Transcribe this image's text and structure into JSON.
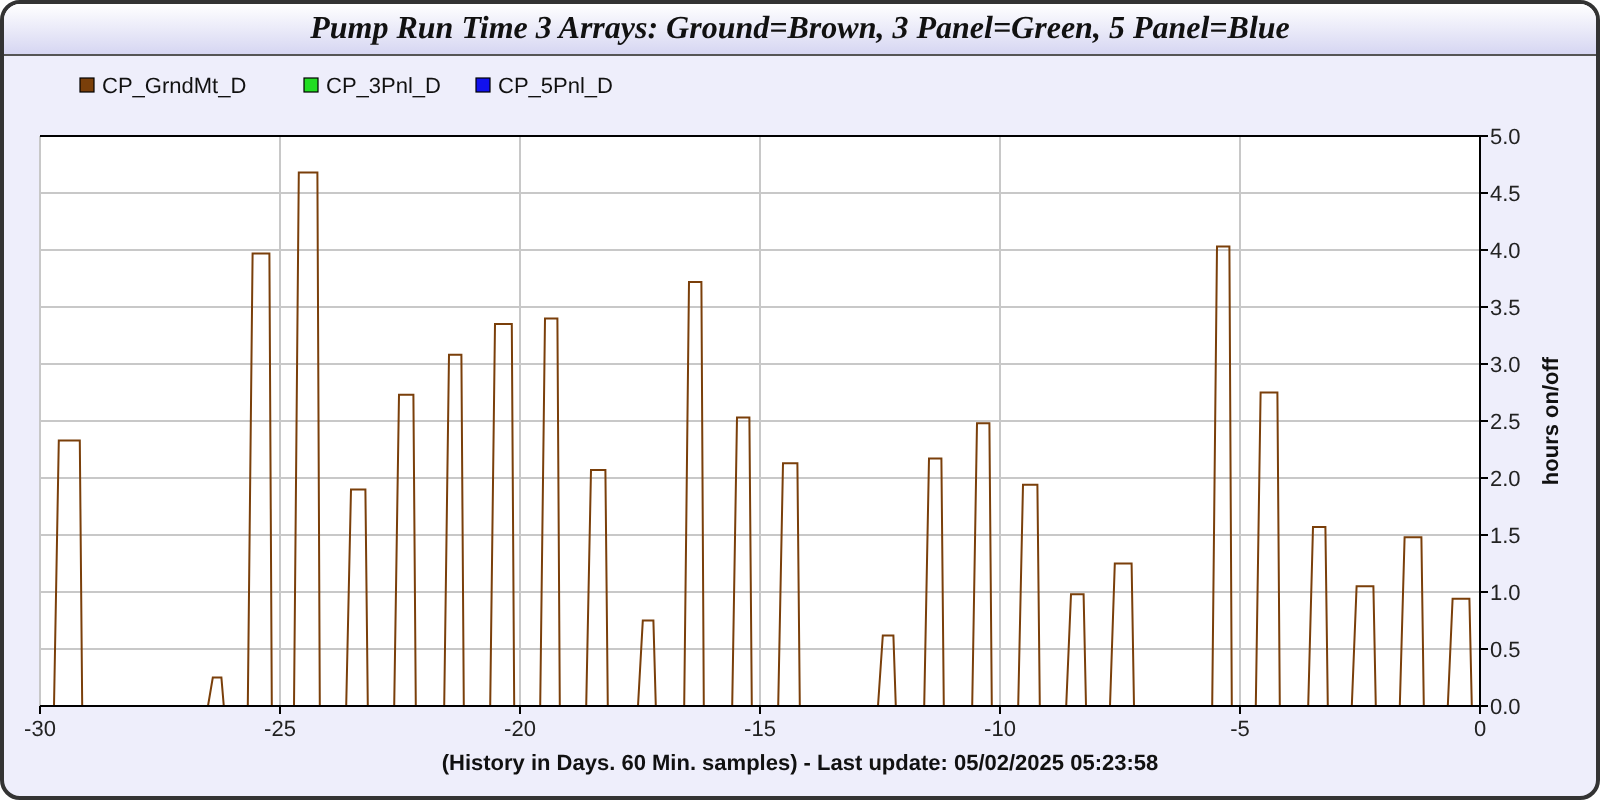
{
  "window": {
    "title": "Pump Run Time 3 Arrays: Ground=Brown, 3 Panel=Green, 5 Panel=Blue"
  },
  "legend": [
    {
      "label": "CP_3Pnl_D",
      "color": "#22dd22"
    },
    {
      "label": "CP_5Pnl_D",
      "color": "#1111ee"
    }
  ],
  "chart_data": {
    "type": "line",
    "grid": true,
    "xlabel": "(History in Days. 60 Min. samples) - Last update: 05/02/2025 05:23:58",
    "ylabel": "hours on/off",
    "xlim": [
      -30,
      0
    ],
    "ylim": [
      0,
      5
    ],
    "xticks": [
      -30,
      -25,
      -20,
      -15,
      -10,
      -5,
      0
    ],
    "yticks": [
      {
        "value": 0,
        "label": "0.0"
      },
      {
        "value": 0.5,
        "label": "0.5"
      },
      {
        "value": 1,
        "label": "1.0"
      },
      {
        "value": 1.5,
        "label": "1.5"
      },
      {
        "value": 2,
        "label": "2.0"
      },
      {
        "value": 2.5,
        "label": "2.5"
      },
      {
        "value": 3,
        "label": "3.0"
      },
      {
        "value": 3.5,
        "label": "3.5"
      },
      {
        "value": 4,
        "label": "4.0"
      },
      {
        "value": 4.5,
        "label": "4.5"
      },
      {
        "value": 5,
        "label": "5.0"
      }
    ],
    "x": [
      -30,
      -29.71,
      -29.61,
      -29.17,
      -29.12,
      -26.5,
      -26.4,
      -26.22,
      -26.17,
      -25.67,
      -25.57,
      -25.22,
      -25.17,
      -24.71,
      -24.61,
      -24.22,
      -24.17,
      -23.62,
      -23.52,
      -23.22,
      -23.17,
      -22.62,
      -22.52,
      -22.22,
      -22.17,
      -21.58,
      -21.48,
      -21.22,
      -21.17,
      -20.62,
      -20.52,
      -20.17,
      -20.12,
      -19.58,
      -19.48,
      -19.22,
      -19.17,
      -18.62,
      -18.52,
      -18.22,
      -18.17,
      -17.54,
      -17.44,
      -17.22,
      -17.17,
      -16.58,
      -16.48,
      -16.22,
      -16.17,
      -15.58,
      -15.48,
      -15.22,
      -15.17,
      -14.62,
      -14.52,
      -14.22,
      -14.17,
      -12.54,
      -12.44,
      -12.22,
      -12.17,
      -11.58,
      -11.48,
      -11.22,
      -11.17,
      -10.58,
      -10.48,
      -10.22,
      -10.17,
      -9.62,
      -9.52,
      -9.22,
      -9.17,
      -8.62,
      -8.52,
      -8.26,
      -8.21,
      -7.71,
      -7.61,
      -7.26,
      -7.21,
      -5.58,
      -5.48,
      -5.22,
      -5.17,
      -4.67,
      -4.57,
      -4.22,
      -4.17,
      -3.58,
      -3.48,
      -3.22,
      -3.17,
      -2.67,
      -2.57,
      -2.22,
      -2.17,
      -1.67,
      -1.57,
      -1.22,
      -1.17,
      -0.67,
      -0.57,
      -0.22,
      -0.17,
      0
    ],
    "series": [
      {
        "name": "CP_GrndMt_D",
        "color": "#7a3f0a",
        "values": [
          0,
          0,
          2.33,
          2.33,
          0,
          0,
          0.25,
          0.25,
          0,
          0,
          3.97,
          3.97,
          0,
          0,
          4.68,
          4.68,
          0,
          0,
          1.9,
          1.9,
          0,
          0,
          2.73,
          2.73,
          0,
          0,
          3.08,
          3.08,
          0,
          0,
          3.35,
          3.35,
          0,
          0,
          3.4,
          3.4,
          0,
          0,
          2.07,
          2.07,
          0,
          0,
          0.75,
          0.75,
          0,
          0,
          3.72,
          3.72,
          0,
          0,
          2.53,
          2.53,
          0,
          0,
          2.13,
          2.13,
          0,
          0,
          0.62,
          0.62,
          0,
          0,
          2.17,
          2.17,
          0,
          0,
          2.48,
          2.48,
          0,
          0,
          1.94,
          1.94,
          0,
          0,
          0.98,
          0.98,
          0,
          0,
          1.25,
          1.25,
          0,
          0,
          4.03,
          4.03,
          0,
          0,
          2.75,
          2.75,
          0,
          0,
          1.57,
          1.57,
          0,
          0,
          1.05,
          1.05,
          0,
          0,
          1.48,
          1.48,
          0,
          0,
          0.94,
          0.94,
          0,
          0
        ]
      }
    ]
  }
}
